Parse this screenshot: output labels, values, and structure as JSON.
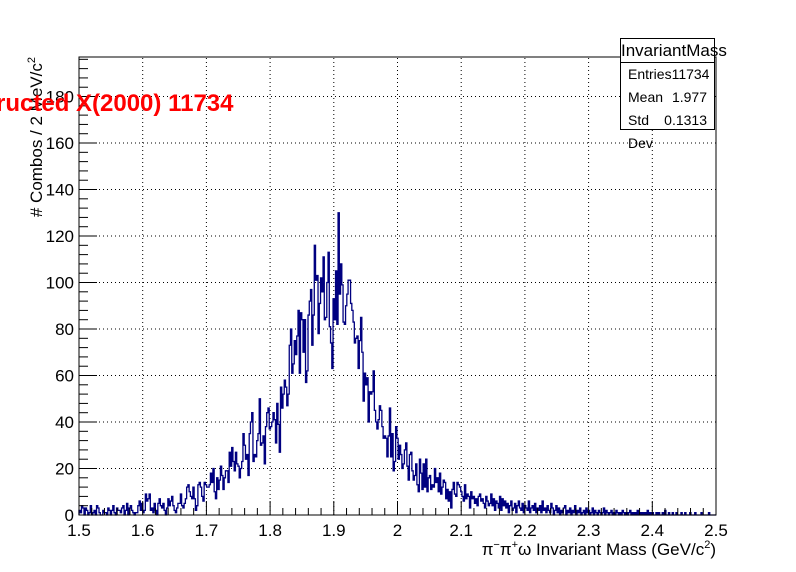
{
  "overlay_title": "ructed X(2000) 11734",
  "stats": {
    "name": "InvariantMass",
    "rows": [
      {
        "label": "Entries",
        "value": "11734"
      },
      {
        "label": "Mean",
        "value": "1.977"
      },
      {
        "label": "Std Dev",
        "value": "0.1313"
      }
    ]
  },
  "chart_data": {
    "type": "histogram",
    "title": "",
    "xlabel_parts": [
      "π",
      "−",
      "π",
      "+",
      "ω Invariant Mass (GeV/c",
      "2",
      ")"
    ],
    "ylabel_parts": [
      "# Combos / 2 MeV/c",
      "2"
    ],
    "xlim": [
      1.5,
      2.5
    ],
    "ylim": [
      0,
      197
    ],
    "bin_width": 0.002,
    "grid": true,
    "legend": "top-right stats box",
    "x_ticks": [
      1.5,
      1.6,
      1.7,
      1.8,
      1.9,
      2.0,
      2.1,
      2.2,
      2.3,
      2.4,
      2.5
    ],
    "x_tick_labels": [
      "1.5",
      "1.6",
      "1.7",
      "1.8",
      "1.9",
      "2",
      "2.1",
      "2.2",
      "2.3",
      "2.4",
      "2.5"
    ],
    "y_ticks": [
      0,
      20,
      40,
      60,
      80,
      100,
      120,
      140,
      160,
      180
    ],
    "y_tick_labels": [
      "0",
      "20",
      "40",
      "60",
      "80",
      "100",
      "120",
      "140",
      "160",
      "180"
    ],
    "line_color": "#000080",
    "values": [
      2,
      1,
      4,
      3,
      0,
      3,
      2,
      0,
      1,
      4,
      0,
      1,
      2,
      0,
      4,
      3,
      1,
      0,
      0,
      2,
      1,
      1,
      0,
      3,
      2,
      0,
      2,
      4,
      1,
      0,
      3,
      2,
      2,
      1,
      3,
      4,
      0,
      2,
      5,
      0,
      3,
      4,
      2,
      1,
      0,
      1,
      1,
      4,
      6,
      2,
      5,
      1,
      2,
      9,
      6,
      7,
      9,
      2,
      3,
      1,
      5,
      2,
      0,
      5,
      7,
      4,
      3,
      5,
      2,
      0,
      3,
      7,
      4,
      6,
      8,
      4,
      2,
      1,
      3,
      5,
      5,
      9,
      4,
      3,
      5,
      7,
      12,
      13,
      10,
      8,
      7,
      12,
      7,
      2,
      4,
      13,
      14,
      12,
      8,
      6,
      14,
      13,
      12,
      12,
      13,
      18,
      14,
      20,
      10,
      7,
      16,
      11,
      15,
      21,
      17,
      11,
      16,
      19,
      19,
      14,
      27,
      21,
      29,
      23,
      19,
      27,
      22,
      21,
      16,
      20,
      23,
      35,
      30,
      24,
      26,
      17,
      35,
      40,
      44,
      23,
      26,
      25,
      32,
      35,
      50,
      30,
      31,
      34,
      22,
      38,
      44,
      46,
      37,
      38,
      40,
      44,
      41,
      31,
      48,
      39,
      27,
      55,
      46,
      52,
      58,
      55,
      47,
      52,
      73,
      80,
      61,
      65,
      75,
      69,
      77,
      88,
      61,
      87,
      84,
      70,
      84,
      57,
      62,
      86,
      92,
      97,
      73,
      86,
      116,
      101,
      103,
      78,
      91,
      102,
      96,
      111,
      84,
      85,
      100,
      113,
      81,
      74,
      63,
      93,
      84,
      105,
      82,
      130,
      95,
      108,
      99,
      83,
      82,
      90,
      95,
      101,
      101,
      91,
      88,
      83,
      74,
      76,
      77,
      63,
      75,
      85,
      70,
      49,
      61,
      56,
      59,
      40,
      53,
      52,
      53,
      62,
      45,
      40,
      37,
      41,
      47,
      45,
      38,
      33,
      34,
      33,
      25,
      34,
      46,
      25,
      35,
      19,
      23,
      38,
      33,
      24,
      30,
      26,
      20,
      22,
      28,
      31,
      21,
      15,
      26,
      27,
      19,
      15,
      17,
      22,
      13,
      10,
      24,
      18,
      11,
      22,
      12,
      24,
      10,
      16,
      17,
      11,
      13,
      12,
      20,
      14,
      16,
      10,
      18,
      9,
      12,
      15,
      14,
      7,
      11,
      6,
      10,
      3,
      11,
      14,
      9,
      8,
      14,
      13,
      12,
      10,
      8,
      6,
      13,
      7,
      9,
      8,
      3,
      10,
      7,
      8,
      5,
      7,
      4,
      8,
      9,
      6,
      7,
      5,
      3,
      8,
      6,
      4,
      5,
      9,
      4,
      7,
      2,
      6,
      5,
      3,
      8,
      2,
      7,
      4,
      6,
      3,
      5,
      1,
      4,
      6,
      2,
      3,
      5,
      1,
      4,
      6,
      3,
      2,
      5,
      1,
      4,
      3,
      2,
      6,
      1,
      3,
      4,
      2,
      5,
      1,
      3,
      2,
      4,
      1,
      6,
      2,
      3,
      1,
      4,
      2,
      1,
      5,
      3,
      0,
      2,
      4,
      1,
      3,
      0,
      2,
      1,
      3,
      4,
      0,
      2,
      1,
      3,
      0,
      2,
      1,
      4,
      0,
      2,
      1,
      3,
      0,
      1,
      2,
      0,
      3,
      1,
      2,
      0,
      1,
      3,
      0,
      2,
      1,
      0,
      2,
      1,
      0,
      1,
      3,
      0,
      2,
      1,
      0,
      1,
      2,
      0,
      1,
      0,
      2,
      1,
      0,
      1,
      0,
      2,
      1,
      0,
      1,
      0,
      1,
      2,
      0,
      1,
      0,
      1,
      0,
      2,
      0,
      1,
      0,
      1,
      0,
      1,
      0,
      2,
      0,
      1,
      0,
      1,
      0,
      0,
      1,
      0,
      1,
      0,
      0,
      1,
      0,
      2,
      0,
      0,
      1,
      0,
      0,
      1,
      0,
      0,
      1,
      0,
      0,
      0,
      1,
      0,
      0,
      1,
      0,
      0,
      0,
      1,
      0,
      0,
      0,
      1,
      0,
      0,
      0,
      0,
      1,
      0,
      0,
      0,
      0,
      0,
      1,
      0,
      0,
      0,
      0,
      0
    ]
  }
}
